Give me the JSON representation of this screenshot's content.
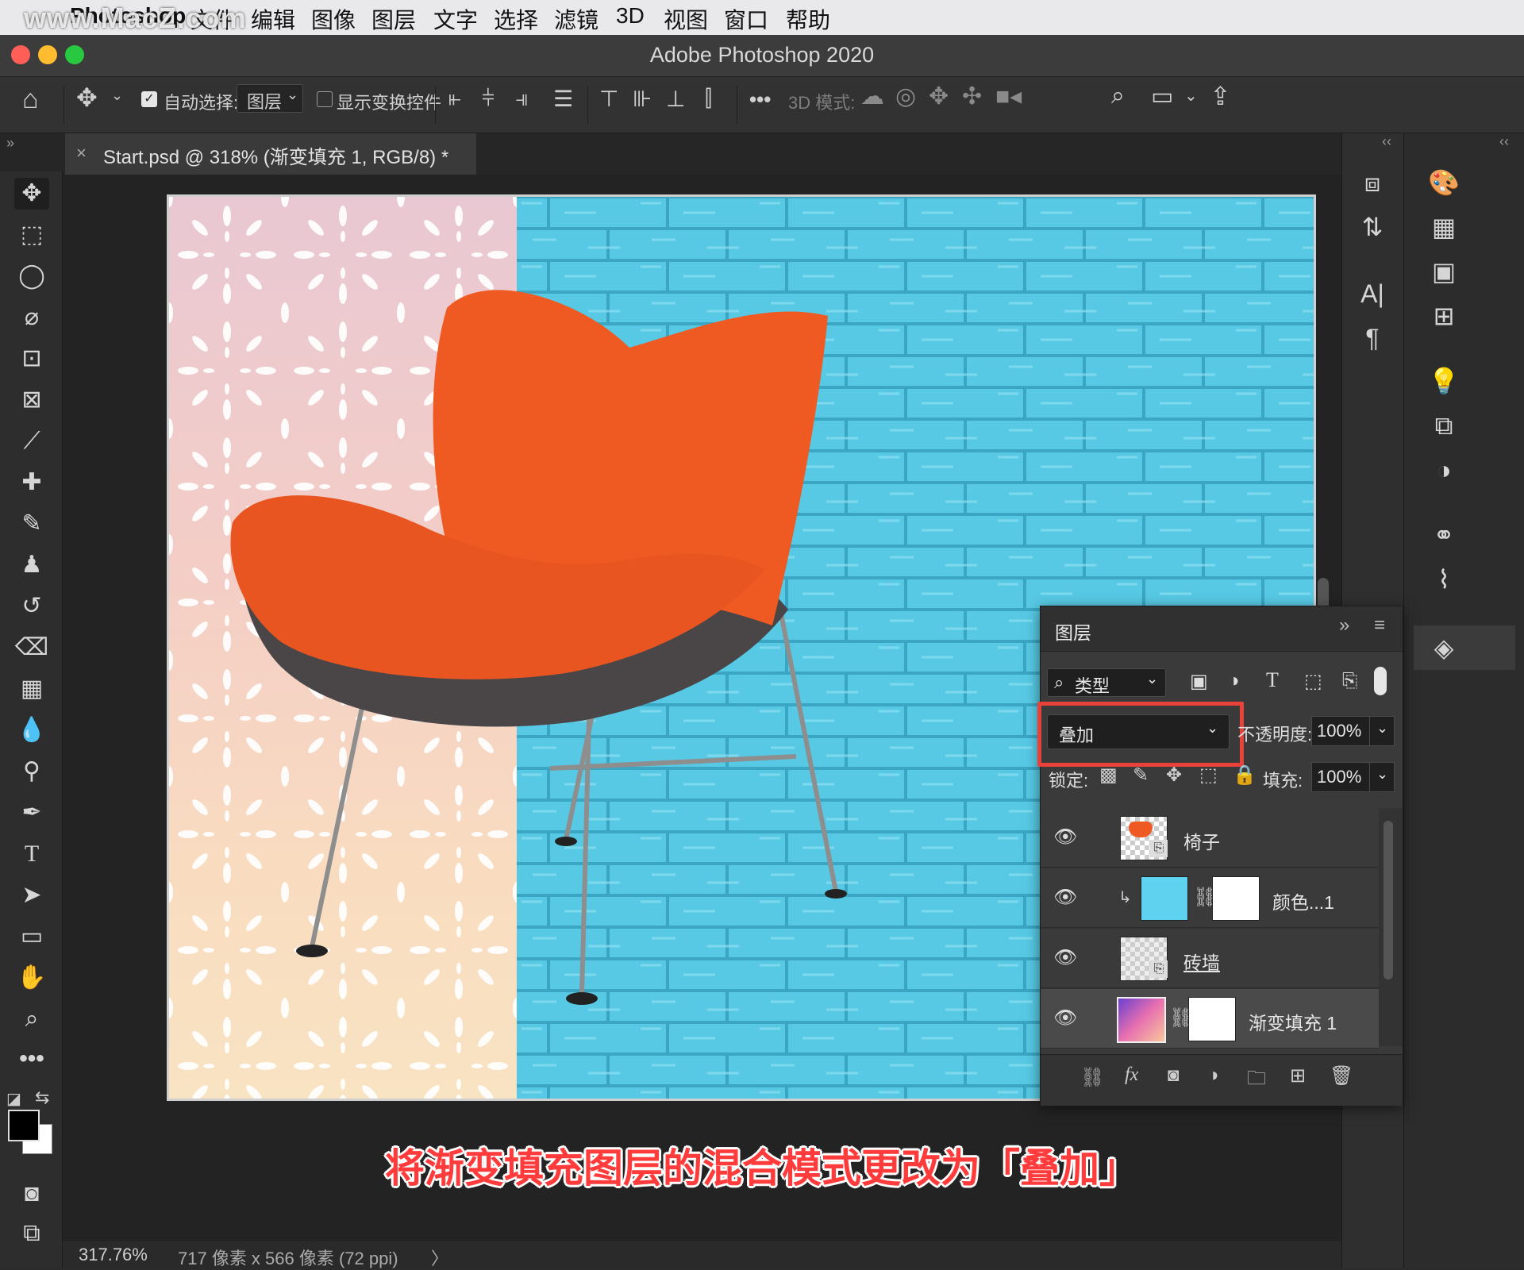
{
  "menubar": {
    "watermark": "www.MacZ.com",
    "app_name": "Photoshop",
    "items": [
      "文件",
      "编辑",
      "图像",
      "图层",
      "文字",
      "选择",
      "滤镜",
      "3D",
      "视图",
      "窗口",
      "帮助"
    ]
  },
  "window": {
    "title": "Adobe Photoshop 2020"
  },
  "options": {
    "auto_select_label": "自动选择:",
    "auto_select_value": "图层",
    "show_transform_label": "显示变换控件",
    "mode_3d_label": "3D 模式:",
    "more": "•••"
  },
  "document_tab": {
    "title": "Start.psd @ 318% (渐变填充 1, RGB/8) *"
  },
  "status": {
    "zoom": "317.76%",
    "doc_info": "717 像素 x 566 像素 (72 ppi)",
    "arrow": "〉"
  },
  "layers_panel": {
    "title": "图层",
    "filter_label": "类型",
    "blend_mode": "叠加",
    "opacity_label": "不透明度:",
    "opacity_value": "100%",
    "lock_label": "锁定:",
    "fill_label": "填充:",
    "fill_value": "100%",
    "layers": [
      {
        "name": "椅子"
      },
      {
        "name": "颜色...1"
      },
      {
        "name": "砖墙"
      },
      {
        "name": "渐变填充 1"
      }
    ],
    "fx_label": "fx"
  },
  "caption": "将渐变填充图层的混合模式更改为「叠加」",
  "colors": {
    "highlight": "#e8423b",
    "brick": "#57c9e4",
    "chair": "#ee5a22"
  }
}
